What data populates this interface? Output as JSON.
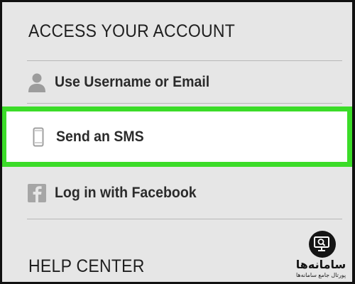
{
  "sections": {
    "access_title": "ACCESS YOUR ACCOUNT",
    "help_title": "HELP CENTER"
  },
  "menu": {
    "items": [
      {
        "label": "Use Username or Email",
        "icon": "person-icon",
        "highlighted": false
      },
      {
        "label": "Send an SMS",
        "icon": "phone-icon",
        "highlighted": true
      },
      {
        "label": "Log in with Facebook",
        "icon": "facebook-icon",
        "highlighted": false
      }
    ]
  },
  "watermark": {
    "title": "سامانه‌ها",
    "subtitle": "پورتال جامع سامانه‌ها",
    "icon": "magnifier-monitor-icon"
  },
  "colors": {
    "highlight_border": "#3bdc28",
    "background": "#e6e6e6",
    "icon_gray": "#9c9c9c"
  }
}
